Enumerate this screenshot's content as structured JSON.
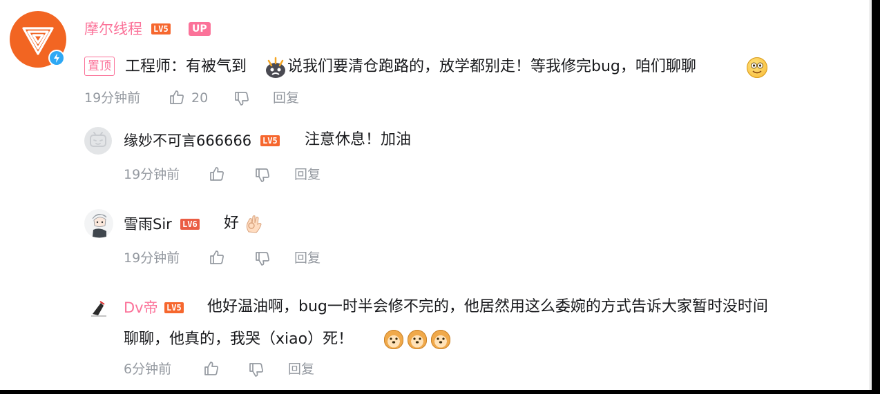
{
  "main_comment": {
    "username": "摩尔线程",
    "level_badge": "LV5",
    "up_badge": "UP",
    "pinned_label": "置顶",
    "text_part1": "工程师：有被气到",
    "text_part2": "说我们要清仓跑路的，放学都别走！等我修完bug，咱们聊聊",
    "time": "19分钟前",
    "likes": "20",
    "reply_label": "回复",
    "emoji_1": "angry-emoji",
    "emoji_2": "smile-emoji"
  },
  "replies": [
    {
      "username": "缘妙不可言666666",
      "level_badge": "LV5",
      "text": "注意休息！加油",
      "time": "19分钟前",
      "reply_label": "回复"
    },
    {
      "username": "雪雨Sir",
      "level_badge": "LV6",
      "text": "好",
      "emoji": "ok-hand-emoji",
      "time": "19分钟前",
      "reply_label": "回复"
    },
    {
      "username": "Dv帝",
      "level_badge": "LV5",
      "text_line1": "他好温油啊，bug一时半会修不完的，他居然用这么委婉的方式告诉大家暂时没时间",
      "text_line2": "聊聊，他真的，我哭（xiao）死！",
      "emoji": "doge-emoji",
      "time": "6分钟前",
      "reply_label": "回复"
    }
  ],
  "colors": {
    "brand_pink": "#fb7299",
    "level_orange": "#f6672e",
    "level_red": "#ea5d44",
    "avatar_orange": "#f26522",
    "verify_blue": "#2ea8f4",
    "meta_gray": "#9499a0"
  }
}
